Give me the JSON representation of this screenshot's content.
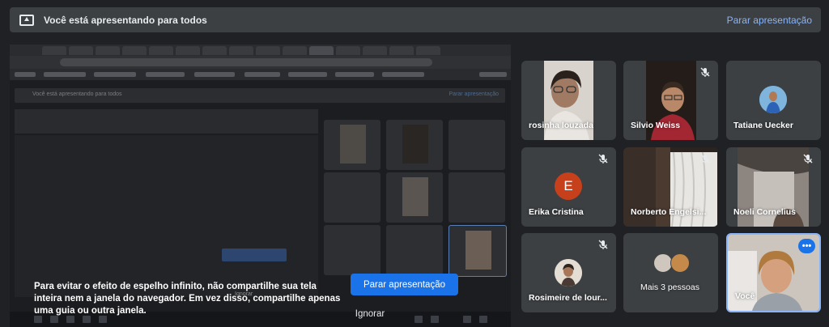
{
  "present_bar": {
    "icon": "present-to-all-icon",
    "message": "Você está apresentando para todos",
    "stop_label": "Parar apresentação"
  },
  "warning": {
    "text": "Para evitar o efeito de espelho infinito, não compartilhe sua tela inteira nem a janela do navegador. Em vez disso, compartilhe apenas uma guia ou outra janela.",
    "primary_button": "Parar apresentação",
    "ignore_button": "Ignorar"
  },
  "participants": [
    {
      "name": "rosinha louzada",
      "muted": false
    },
    {
      "name": "Silvio Weiss",
      "muted": true
    },
    {
      "name": "Tatiane Uecker",
      "muted": false
    },
    {
      "name": "Erika Cristina",
      "muted": true,
      "avatar_letter": "E",
      "avatar_color": "#c5401b"
    },
    {
      "name": "Norberto Engelsi...",
      "muted": true
    },
    {
      "name": "Noeli Cornelius",
      "muted": true
    },
    {
      "name": "Rosimeire de lour...",
      "muted": true
    },
    {
      "name": "Mais 3 pessoas",
      "muted": false
    },
    {
      "name": "Você",
      "muted": false,
      "more_options_icon": "more-horiz-icon"
    }
  ],
  "colors": {
    "background": "#202124",
    "tile": "#3c4043",
    "accent_blue": "#1a73e8",
    "link_blue": "#8ab4f8"
  }
}
